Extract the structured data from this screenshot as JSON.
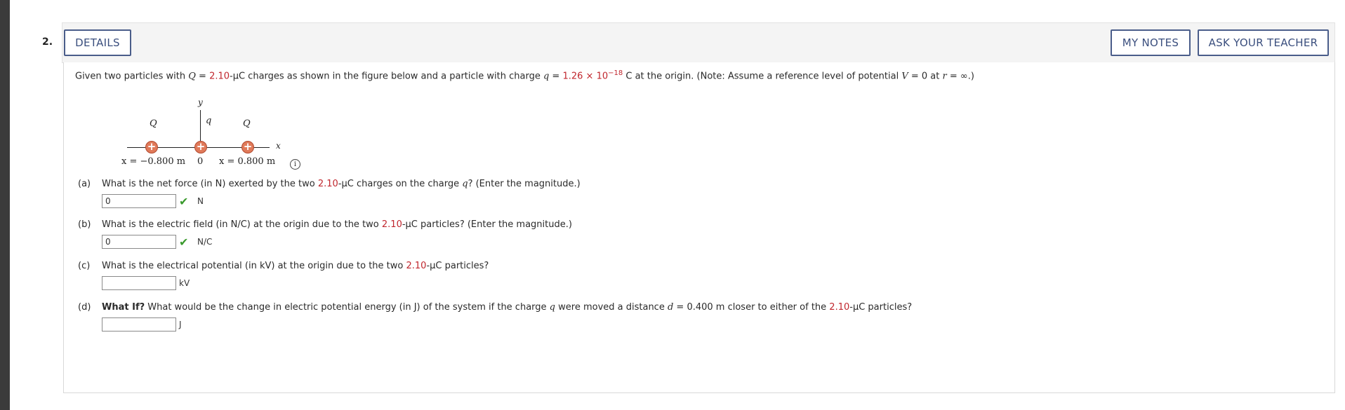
{
  "question": {
    "number": "2.",
    "details_label": "DETAILS",
    "my_notes_label": "MY NOTES",
    "ask_teacher_label": "ASK YOUR TEACHER"
  },
  "prompt": {
    "t1": "Given two particles with ",
    "Q": "Q",
    "eq1": " = ",
    "Q_value": "2.10",
    "t2": "-µC charges as shown in the figure below and a particle with charge ",
    "q": "q",
    "eq2": " = ",
    "q_value": "1.26 × 10",
    "q_exp": "−18",
    "t3": " C at the origin. (Note: Assume a reference level of potential ",
    "V": "V",
    "t4": " = 0 at ",
    "r": "r",
    "t5": " = ∞.)"
  },
  "figure": {
    "left_Q": "Q",
    "right_Q": "Q",
    "y_axis": "y",
    "q_label": "q",
    "x_axis": "x",
    "left_pos": "x = −0.800 m",
    "origin": "0",
    "right_pos": "x = 0.800 m",
    "plus": "+",
    "info": "i"
  },
  "parts": [
    {
      "label": "(a)",
      "text_1": "What is the net force (in N) exerted by the two ",
      "value": "2.10",
      "text_2": "-µC charges on the charge ",
      "q": "q",
      "text_3": "? (Enter the magnitude.)",
      "answer": "0",
      "unit": "N",
      "status": "correct"
    },
    {
      "label": "(b)",
      "text_1": "What is the electric field (in N/C) at the origin due to the two ",
      "value": "2.10",
      "text_2": "-µC particles? (Enter the magnitude.)",
      "answer": "0",
      "unit": "N/C",
      "status": "correct"
    },
    {
      "label": "(c)",
      "text_1": "What is the electrical potential (in kV) at the origin due to the two ",
      "value": "2.10",
      "text_2": "-µC particles?",
      "answer": "",
      "unit": "kV"
    },
    {
      "label": "(d)",
      "bold": "What If?",
      "text_1": " What would be the change in electric potential energy (in J) of the system if the charge ",
      "q": "q",
      "text_2": " were moved a distance ",
      "d": "d",
      "text_3": " = 0.400 m closer to either of the ",
      "value": "2.10",
      "text_4": "-µC particles?",
      "answer": "",
      "unit": "J"
    }
  ],
  "icons": {
    "check": "✔"
  },
  "colors": {
    "highlight": "#c0262d",
    "button_border": "#4a5d8a",
    "check": "#3a9a2d"
  }
}
